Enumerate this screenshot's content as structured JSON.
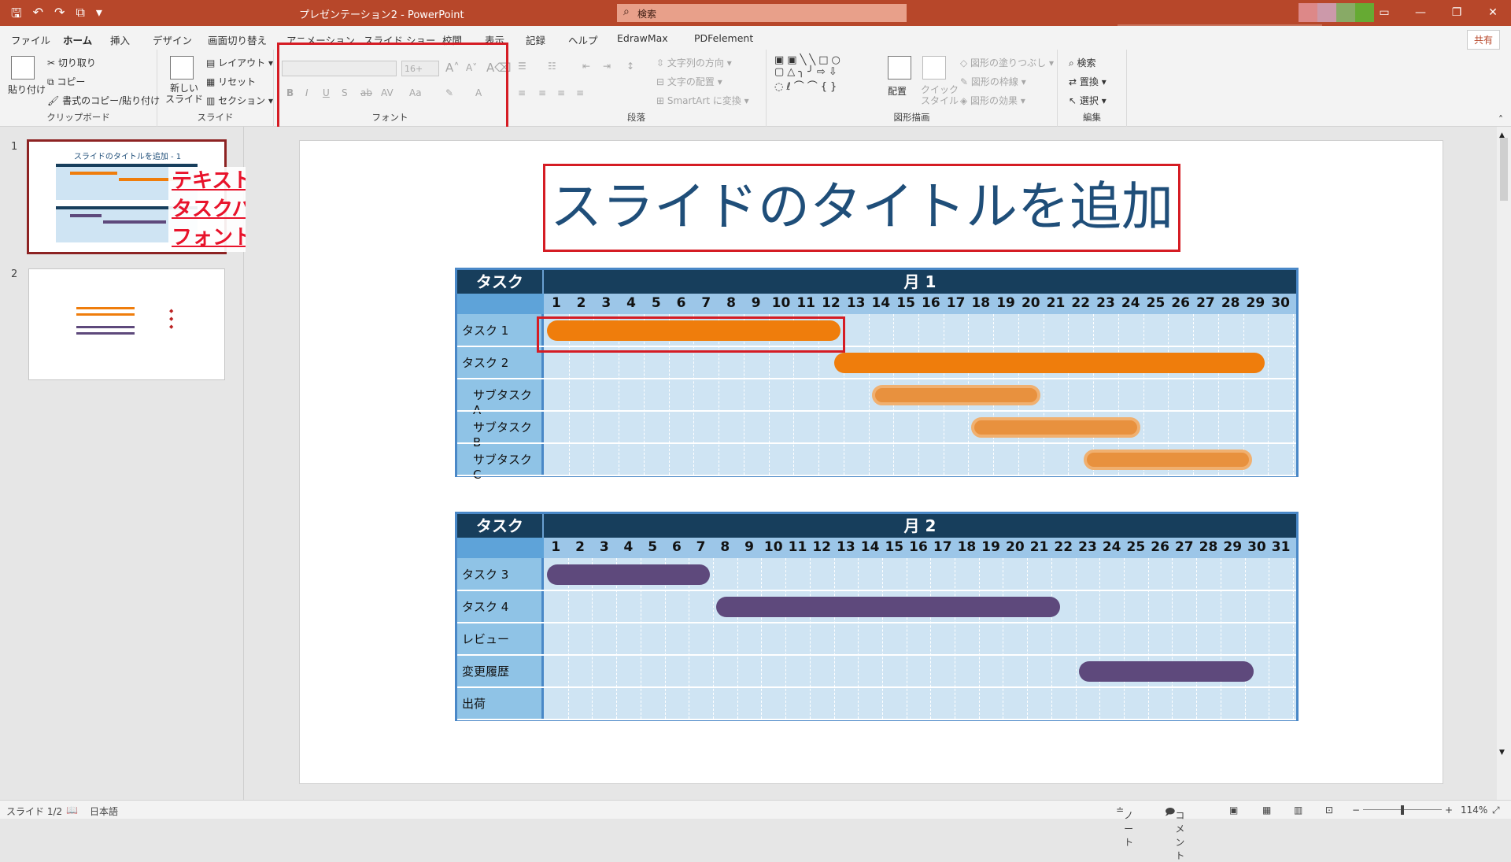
{
  "window": {
    "doc_title": "プレゼンテーション2 - PowerPoint",
    "search_placeholder": "検索"
  },
  "tabs": [
    "ファイル",
    "ホーム",
    "挿入",
    "デザイン",
    "画面切り替え",
    "アニメーション",
    "スライド ショー",
    "校閲",
    "表示",
    "記録",
    "ヘルプ",
    "EdrawMax",
    "PDFelement"
  ],
  "active_tab": "ホーム",
  "share_label": "共有",
  "ribbon": {
    "clipboard": {
      "label": "クリップボード",
      "paste": "貼り付け",
      "cut": "切り取り",
      "copy": "コピー",
      "format_painter": "書式のコピー/貼り付け"
    },
    "slides": {
      "label": "スライド",
      "new_slide": "新しい\nスライド",
      "layout": "レイアウト",
      "reset": "リセット",
      "section": "セクション"
    },
    "font": {
      "label": "フォント",
      "size": "16+"
    },
    "paragraph": {
      "label": "段落",
      "text_direction": "文字列の方向",
      "align_text": "文字の配置",
      "smartart": "SmartArt に変換"
    },
    "drawing": {
      "label": "図形描画",
      "arrange": "配置",
      "quick_styles": "クイック\nスタイル",
      "shape_fill": "図形の塗りつぶし",
      "shape_outline": "図形の枠線",
      "shape_effects": "図形の効果"
    },
    "editing": {
      "label": "編集",
      "find": "検索",
      "replace": "置換",
      "select": "選択"
    }
  },
  "thumbnails": [
    {
      "num": "1",
      "title": "スライドのタイトルを追加 - 1"
    },
    {
      "num": "2",
      "title": ""
    }
  ],
  "annotation": {
    "line1": "テキストボックスや画像",
    "line2": "タスクバーを選択することで",
    "line3": "フォントや色、デザインが変更可能"
  },
  "slide": {
    "title": "スライドのタイトルを追加 - 1",
    "gantt1": {
      "task_header": "タスク",
      "month": "月 1",
      "days": 30,
      "rows": [
        "タスク 1",
        "タスク 2",
        "サブタスク A",
        "サブタスク B",
        "サブタスク C"
      ],
      "bars": [
        {
          "row": 0,
          "start": 1,
          "end": 12,
          "style": "orange"
        },
        {
          "row": 1,
          "start": 12.5,
          "end": 29,
          "style": "orange"
        },
        {
          "row": 2,
          "start": 14,
          "end": 20,
          "style": "light"
        },
        {
          "row": 3,
          "start": 18,
          "end": 24,
          "style": "light"
        },
        {
          "row": 4,
          "start": 22.5,
          "end": 28.5,
          "style": "light"
        }
      ]
    },
    "gantt2": {
      "task_header": "タスク",
      "month": "月 2",
      "days": 31,
      "rows": [
        "タスク 3",
        "タスク 4",
        "レビュー",
        "変更履歴",
        "出荷"
      ],
      "bars": [
        {
          "row": 0,
          "start": 1,
          "end": 7,
          "style": "purple"
        },
        {
          "row": 1,
          "start": 8,
          "end": 21.5,
          "style": "purple"
        },
        {
          "row": 3,
          "start": 23,
          "end": 29.5,
          "style": "purple"
        }
      ]
    }
  },
  "status": {
    "slide": "スライド 1/2",
    "language": "日本語",
    "notes": "ノート",
    "comments": "コメント",
    "zoom": "114%"
  },
  "colors": {
    "accent": "#b7472a",
    "title": "#1f4e79",
    "orange": "#ef7d0c",
    "purple": "#5e497c",
    "annot": "#e8132b"
  }
}
